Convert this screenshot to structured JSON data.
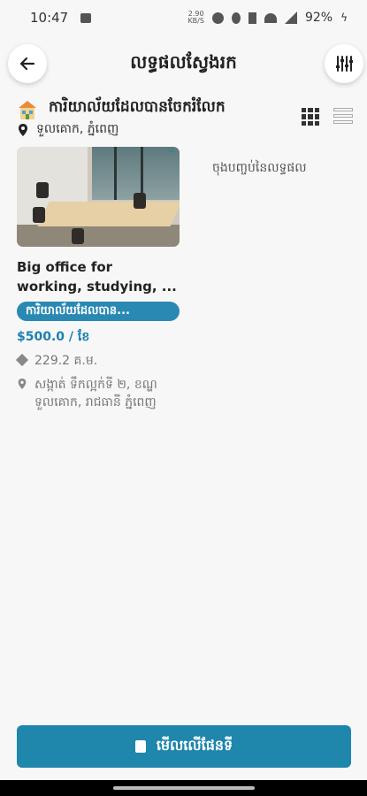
{
  "status_bar": {
    "time": "10:47",
    "speed": "2.90\nKB/S",
    "battery": "92%"
  },
  "app_bar": {
    "title": "លទ្ធផលស្វែងរក",
    "back_icon": "arrow-left-icon",
    "filter_icon": "filter-sliders-icon"
  },
  "header": {
    "category": "ការិយាល័យដែលបានចែករំលែក",
    "location": "ទួលគោក, ភ្នំពេញ"
  },
  "listing": {
    "title": "Big office for working, studying, ...",
    "chip": "ការិយាល័យដែលបាន...",
    "price": "$500.0 / ខែ",
    "area": "229.2 គ.ម.",
    "address": "សង្កាត់ ទឹកល្អក់ទី ២, ខណ្ឌ ទួលគោក, រាជធានី ភ្នំពេញ"
  },
  "end_of_results": "ចុងបញ្ចប់នៃលទ្ធផល",
  "map_button": {
    "label": "មើលលើផែនទី"
  },
  "colors": {
    "accent": "#1f86ac",
    "chip": "#2a89b3",
    "price": "#1d7fb0"
  }
}
